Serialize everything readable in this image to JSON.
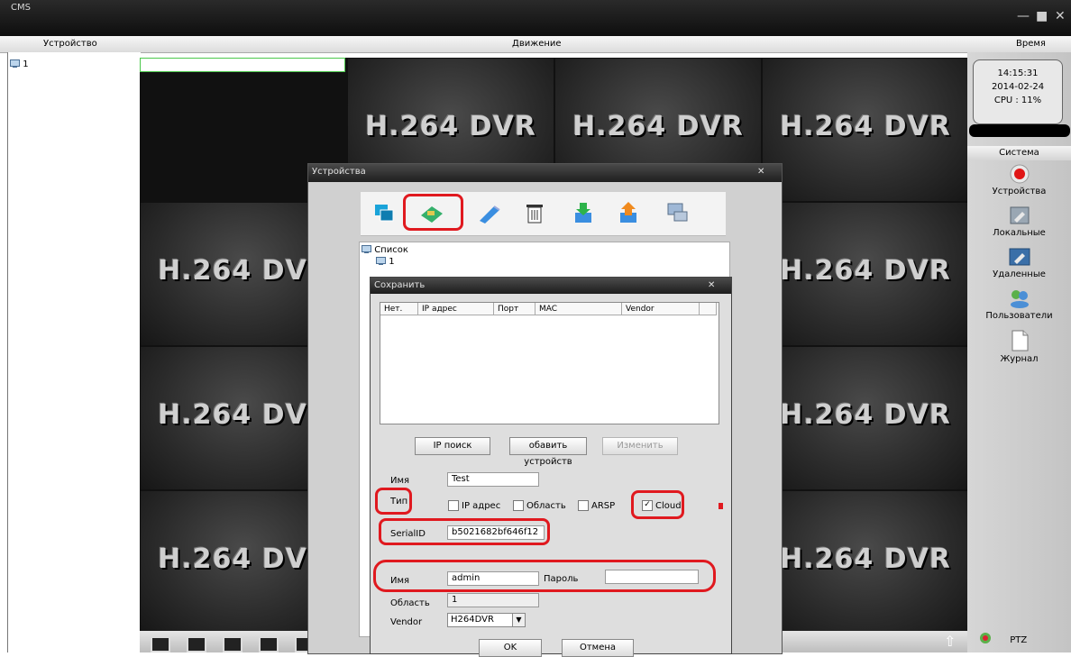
{
  "window": {
    "title": "CMS",
    "controls": [
      "—",
      "■",
      "✕"
    ]
  },
  "header": {
    "device_label": "Устройство",
    "motion_label": "Движение",
    "time_label": "Время"
  },
  "tree": {
    "root": "1"
  },
  "grid": {
    "label": "H.264 DVR"
  },
  "clock": {
    "time": "14:15:31",
    "date": "2014-02-24",
    "cpu": "CPU : 11%"
  },
  "side": {
    "section": "Система",
    "items": [
      {
        "label": "Устройства",
        "icon": "record-icon"
      },
      {
        "label": "Локальные",
        "icon": "local-config-icon"
      },
      {
        "label": "Удаленные",
        "icon": "remote-config-icon"
      },
      {
        "label": "Пользователи",
        "icon": "users-icon"
      },
      {
        "label": "Журнал",
        "icon": "log-icon"
      }
    ],
    "ptz": "PTZ"
  },
  "devices_dialog": {
    "title": "Устройства",
    "list_root": "Список",
    "list_child": "1"
  },
  "save_dialog": {
    "title": "Сохранить",
    "columns": [
      "Нет.",
      "IP адрес",
      "Порт",
      "MAC",
      "Vendor"
    ],
    "buttons": {
      "ip_search": "IP поиск",
      "add_device": "обавить устройств",
      "edit": "Изменить"
    },
    "name_label": "Имя",
    "name_value": "Test",
    "type_label": "Тип",
    "type_options": [
      {
        "label": "IP адрес",
        "checked": false
      },
      {
        "label": "Область",
        "checked": false
      },
      {
        "label": "ARSP",
        "checked": false
      },
      {
        "label": "Cloud",
        "checked": true
      }
    ],
    "serial_label": "SerialID",
    "serial_value": "b5021682bf646f12",
    "user_label": "Имя",
    "user_value": "admin",
    "password_label": "Пароль",
    "password_value": "",
    "area_label": "Область",
    "area_value": "1",
    "vendor_label": "Vendor",
    "vendor_value": "H264DVR",
    "ok": "OK",
    "cancel": "Отмена"
  },
  "colors": {
    "annotation": "#e0191f",
    "selected_cell": "#4bc84b"
  }
}
